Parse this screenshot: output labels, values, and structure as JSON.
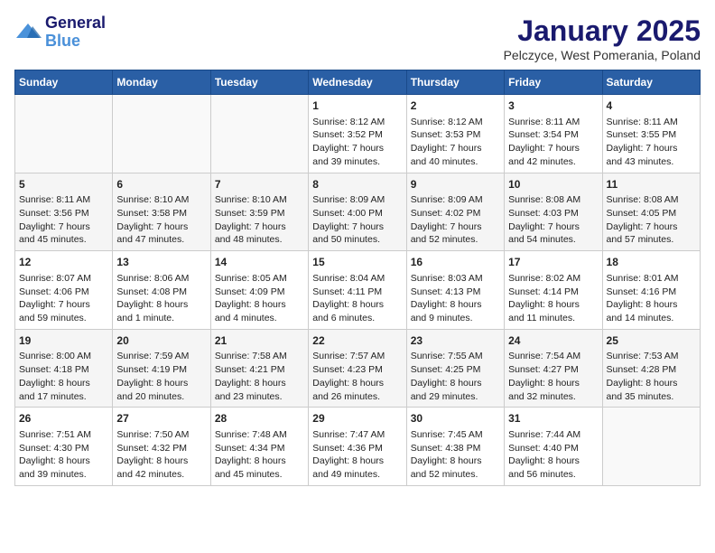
{
  "header": {
    "logo_line1": "General",
    "logo_line2": "Blue",
    "month_title": "January 2025",
    "subtitle": "Pelczyce, West Pomerania, Poland"
  },
  "weekdays": [
    "Sunday",
    "Monday",
    "Tuesday",
    "Wednesday",
    "Thursday",
    "Friday",
    "Saturday"
  ],
  "weeks": [
    [
      {
        "day": "",
        "info": ""
      },
      {
        "day": "",
        "info": ""
      },
      {
        "day": "",
        "info": ""
      },
      {
        "day": "1",
        "info": "Sunrise: 8:12 AM\nSunset: 3:52 PM\nDaylight: 7 hours\nand 39 minutes."
      },
      {
        "day": "2",
        "info": "Sunrise: 8:12 AM\nSunset: 3:53 PM\nDaylight: 7 hours\nand 40 minutes."
      },
      {
        "day": "3",
        "info": "Sunrise: 8:11 AM\nSunset: 3:54 PM\nDaylight: 7 hours\nand 42 minutes."
      },
      {
        "day": "4",
        "info": "Sunrise: 8:11 AM\nSunset: 3:55 PM\nDaylight: 7 hours\nand 43 minutes."
      }
    ],
    [
      {
        "day": "5",
        "info": "Sunrise: 8:11 AM\nSunset: 3:56 PM\nDaylight: 7 hours\nand 45 minutes."
      },
      {
        "day": "6",
        "info": "Sunrise: 8:10 AM\nSunset: 3:58 PM\nDaylight: 7 hours\nand 47 minutes."
      },
      {
        "day": "7",
        "info": "Sunrise: 8:10 AM\nSunset: 3:59 PM\nDaylight: 7 hours\nand 48 minutes."
      },
      {
        "day": "8",
        "info": "Sunrise: 8:09 AM\nSunset: 4:00 PM\nDaylight: 7 hours\nand 50 minutes."
      },
      {
        "day": "9",
        "info": "Sunrise: 8:09 AM\nSunset: 4:02 PM\nDaylight: 7 hours\nand 52 minutes."
      },
      {
        "day": "10",
        "info": "Sunrise: 8:08 AM\nSunset: 4:03 PM\nDaylight: 7 hours\nand 54 minutes."
      },
      {
        "day": "11",
        "info": "Sunrise: 8:08 AM\nSunset: 4:05 PM\nDaylight: 7 hours\nand 57 minutes."
      }
    ],
    [
      {
        "day": "12",
        "info": "Sunrise: 8:07 AM\nSunset: 4:06 PM\nDaylight: 7 hours\nand 59 minutes."
      },
      {
        "day": "13",
        "info": "Sunrise: 8:06 AM\nSunset: 4:08 PM\nDaylight: 8 hours\nand 1 minute."
      },
      {
        "day": "14",
        "info": "Sunrise: 8:05 AM\nSunset: 4:09 PM\nDaylight: 8 hours\nand 4 minutes."
      },
      {
        "day": "15",
        "info": "Sunrise: 8:04 AM\nSunset: 4:11 PM\nDaylight: 8 hours\nand 6 minutes."
      },
      {
        "day": "16",
        "info": "Sunrise: 8:03 AM\nSunset: 4:13 PM\nDaylight: 8 hours\nand 9 minutes."
      },
      {
        "day": "17",
        "info": "Sunrise: 8:02 AM\nSunset: 4:14 PM\nDaylight: 8 hours\nand 11 minutes."
      },
      {
        "day": "18",
        "info": "Sunrise: 8:01 AM\nSunset: 4:16 PM\nDaylight: 8 hours\nand 14 minutes."
      }
    ],
    [
      {
        "day": "19",
        "info": "Sunrise: 8:00 AM\nSunset: 4:18 PM\nDaylight: 8 hours\nand 17 minutes."
      },
      {
        "day": "20",
        "info": "Sunrise: 7:59 AM\nSunset: 4:19 PM\nDaylight: 8 hours\nand 20 minutes."
      },
      {
        "day": "21",
        "info": "Sunrise: 7:58 AM\nSunset: 4:21 PM\nDaylight: 8 hours\nand 23 minutes."
      },
      {
        "day": "22",
        "info": "Sunrise: 7:57 AM\nSunset: 4:23 PM\nDaylight: 8 hours\nand 26 minutes."
      },
      {
        "day": "23",
        "info": "Sunrise: 7:55 AM\nSunset: 4:25 PM\nDaylight: 8 hours\nand 29 minutes."
      },
      {
        "day": "24",
        "info": "Sunrise: 7:54 AM\nSunset: 4:27 PM\nDaylight: 8 hours\nand 32 minutes."
      },
      {
        "day": "25",
        "info": "Sunrise: 7:53 AM\nSunset: 4:28 PM\nDaylight: 8 hours\nand 35 minutes."
      }
    ],
    [
      {
        "day": "26",
        "info": "Sunrise: 7:51 AM\nSunset: 4:30 PM\nDaylight: 8 hours\nand 39 minutes."
      },
      {
        "day": "27",
        "info": "Sunrise: 7:50 AM\nSunset: 4:32 PM\nDaylight: 8 hours\nand 42 minutes."
      },
      {
        "day": "28",
        "info": "Sunrise: 7:48 AM\nSunset: 4:34 PM\nDaylight: 8 hours\nand 45 minutes."
      },
      {
        "day": "29",
        "info": "Sunrise: 7:47 AM\nSunset: 4:36 PM\nDaylight: 8 hours\nand 49 minutes."
      },
      {
        "day": "30",
        "info": "Sunrise: 7:45 AM\nSunset: 4:38 PM\nDaylight: 8 hours\nand 52 minutes."
      },
      {
        "day": "31",
        "info": "Sunrise: 7:44 AM\nSunset: 4:40 PM\nDaylight: 8 hours\nand 56 minutes."
      },
      {
        "day": "",
        "info": ""
      }
    ]
  ]
}
